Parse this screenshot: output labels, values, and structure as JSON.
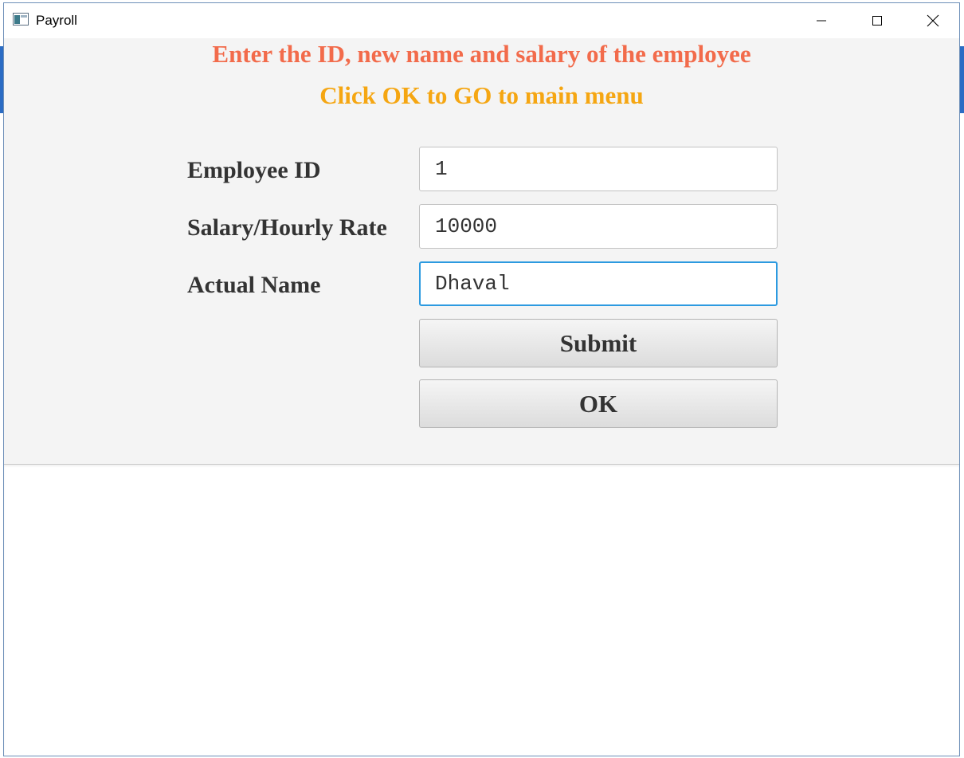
{
  "window": {
    "title": "Payroll"
  },
  "headings": {
    "line1": "Enter the ID, new name and salary of the employee",
    "line2": "Click OK to GO to main menu"
  },
  "form": {
    "employee_id": {
      "label": "Employee ID",
      "value": "1"
    },
    "salary": {
      "label": "Salary/Hourly Rate",
      "value": "10000"
    },
    "name": {
      "label": "Actual Name",
      "value": "Dhaval"
    }
  },
  "buttons": {
    "submit": "Submit",
    "ok": "OK"
  },
  "colors": {
    "heading1": "#f26b4b",
    "heading2": "#f5a612",
    "focus": "#2c9ae0",
    "label": "#333333"
  }
}
